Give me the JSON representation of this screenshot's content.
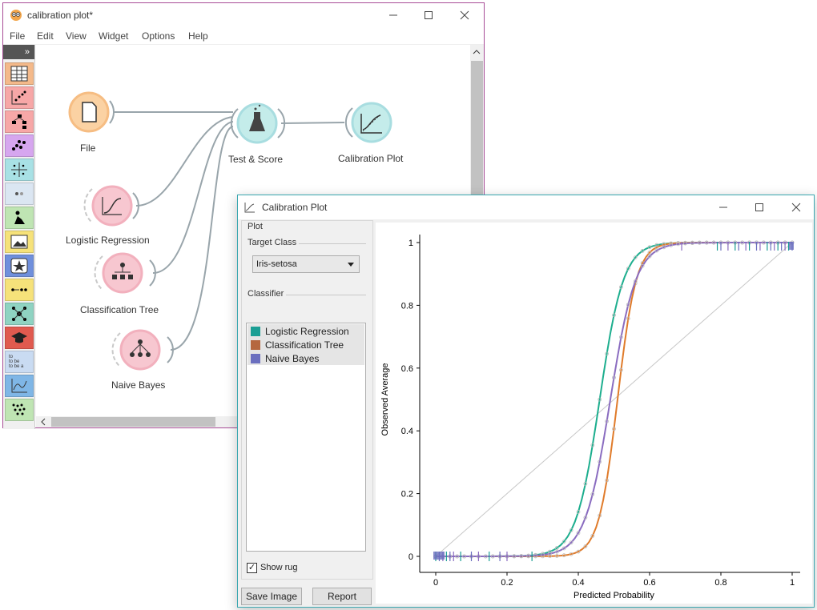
{
  "main_window": {
    "title": "calibration plot*",
    "menu": [
      "File",
      "Edit",
      "View",
      "Widget",
      "Options",
      "Help"
    ],
    "toolbox_toggle": "»",
    "toolbox_text_icon": "to\nto be\nto be a",
    "nodes": {
      "file": "File",
      "test_score": "Test & Score",
      "calibration_plot": "Calibration Plot",
      "logistic_regression": "Logistic Regression",
      "classification_tree": "Classification Tree",
      "naive_bayes": "Naive Bayes"
    }
  },
  "cal_window": {
    "title": "Calibration Plot",
    "plot_group": "Plot",
    "target_class_label": "Target Class",
    "target_class_value": "Iris-setosa",
    "classifier_label": "Classifier",
    "classifiers": [
      {
        "name": "Logistic Regression",
        "color": "#1a9e94"
      },
      {
        "name": "Classification Tree",
        "color": "#b5673f"
      },
      {
        "name": "Naive Bayes",
        "color": "#6b6fbf"
      }
    ],
    "show_rug_label": "Show rug",
    "show_rug_checked": "✓",
    "save_image": "Save Image",
    "report": "Report"
  },
  "chart_data": {
    "type": "line",
    "xlabel": "Predicted Probability",
    "ylabel": "Observed Average",
    "xlim": [
      0,
      1
    ],
    "ylim": [
      0,
      1
    ],
    "x_ticks": [
      "0",
      "0.2",
      "0.4",
      "0.6",
      "0.8",
      "1"
    ],
    "y_ticks": [
      "0",
      "0.2",
      "0.4",
      "0.6",
      "0.8",
      "1"
    ],
    "series": [
      {
        "name": "Logistic Regression",
        "color": "#1dae8e",
        "midpoint": 0.46,
        "steepness": 30
      },
      {
        "name": "Classification Tree",
        "color": "#e07b2a",
        "midpoint": 0.51,
        "steepness": 38
      },
      {
        "name": "Naive Bayes",
        "color": "#8a6cc0",
        "midpoint": 0.49,
        "steepness": 28
      },
      {
        "name": "Diagonal",
        "color": "#c8c8c8",
        "points": [
          [
            0,
            0
          ],
          [
            1,
            1
          ]
        ]
      }
    ],
    "rug": {
      "bottom": [
        0.0,
        0.01,
        0.02,
        0.03,
        0.04,
        0.05,
        0.07,
        0.1,
        0.12,
        0.15,
        0.18,
        0.2,
        0.27
      ],
      "top": [
        0.79,
        0.8,
        0.82,
        0.84,
        0.85,
        0.87,
        0.88,
        0.9,
        0.91,
        0.93,
        0.94,
        0.95,
        0.96,
        0.97,
        0.98,
        0.99,
        1.0,
        0.69
      ]
    }
  }
}
